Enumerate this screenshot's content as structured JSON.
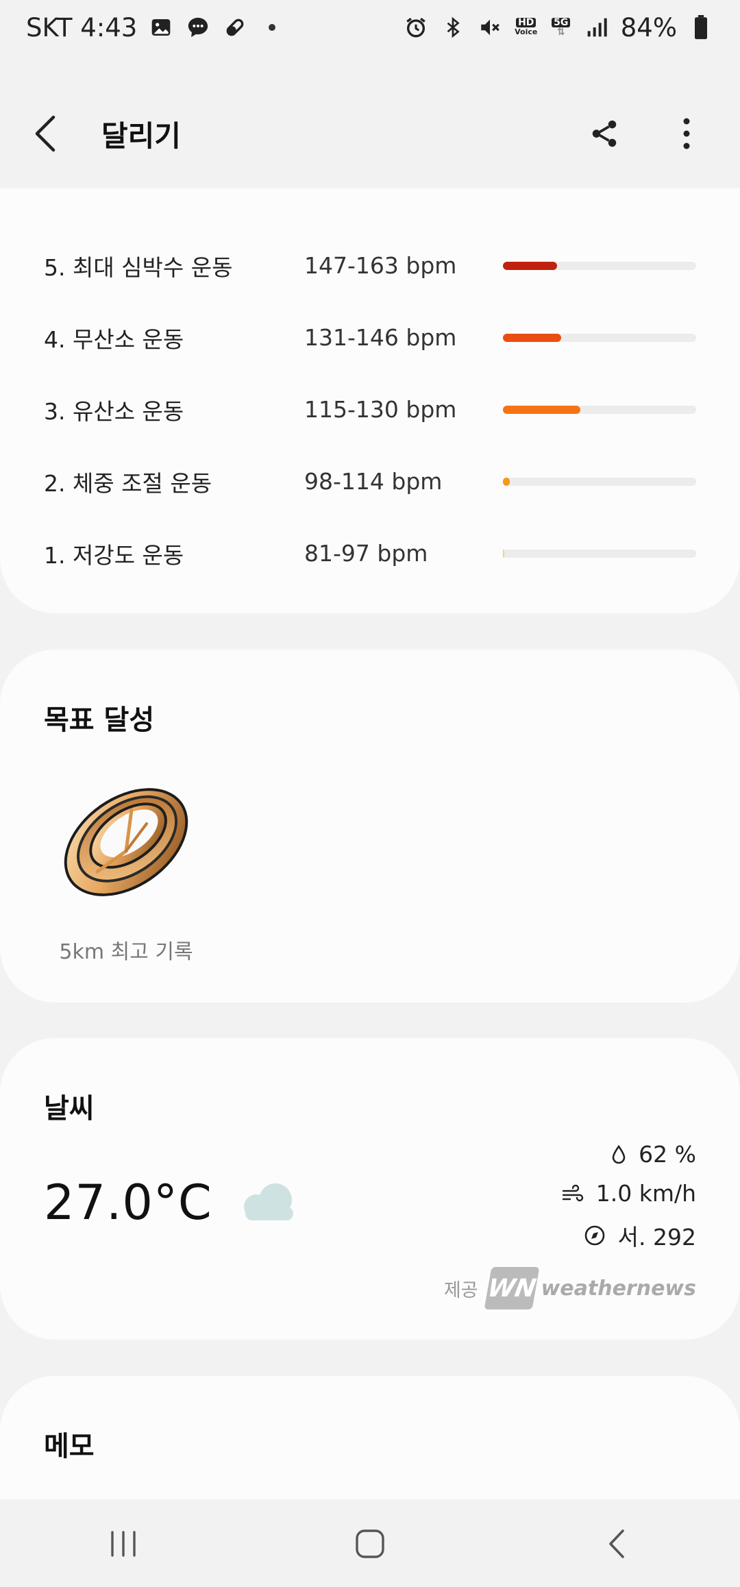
{
  "status_bar": {
    "carrier_time": "SKT 4:43",
    "hd_label": "HD",
    "voice_label": "Voice",
    "network": "5G",
    "battery": "84%"
  },
  "app_bar": {
    "title": "달리기"
  },
  "hr_zones": [
    {
      "label": "5. 최대 심박수 운동",
      "range": "147-163 bpm",
      "fill_fraction": 0.28,
      "color": "#c0220e"
    },
    {
      "label": "4. 무산소 운동",
      "range": "131-146 bpm",
      "fill_fraction": 0.3,
      "color": "#ea4d12"
    },
    {
      "label": "3. 유산소 운동",
      "range": "115-130 bpm",
      "fill_fraction": 0.4,
      "color": "#f57315"
    },
    {
      "label": "2. 체중 조절 운동",
      "range": "98-114 bpm",
      "fill_fraction": 0.035,
      "color": "#f39a19"
    },
    {
      "label": "1. 저강도 운동",
      "range": "81-97 bpm",
      "fill_fraction": 0.006,
      "color": "#f3d85e"
    }
  ],
  "goal": {
    "title": "목표 달성",
    "badge_label": "5km 최고 기록"
  },
  "weather": {
    "title": "날씨",
    "temperature": "27.0°C",
    "humidity": "62 %",
    "wind_speed": "1.0 km/h",
    "wind_direction": "서. 292",
    "provider_prefix": "제공",
    "provider_logo": "WN",
    "provider_name": "weathernews"
  },
  "memo": {
    "title": "메모"
  }
}
